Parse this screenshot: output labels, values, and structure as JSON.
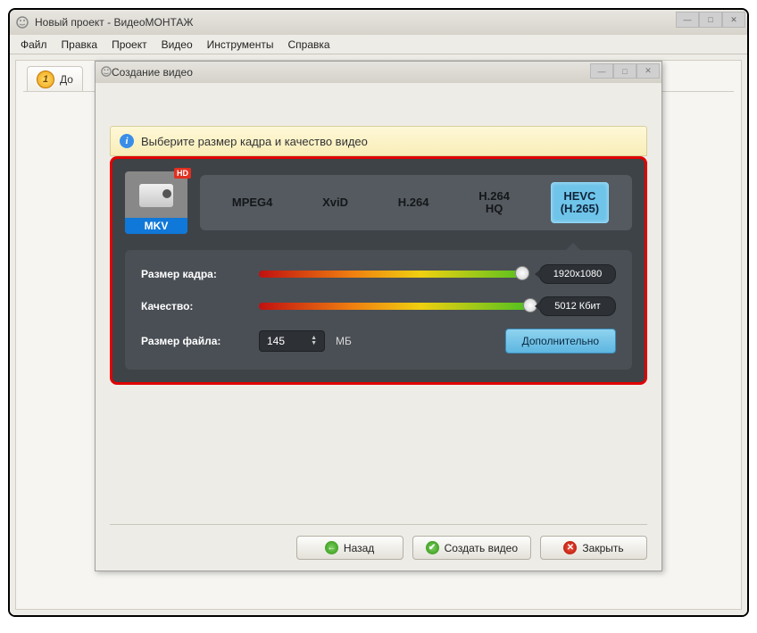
{
  "main_window": {
    "title": "Новый проект - ВидеоМОНТАЖ",
    "menu": [
      "Файл",
      "Правка",
      "Проект",
      "Видео",
      "Инструменты",
      "Справка"
    ],
    "tab": {
      "number": "1",
      "label": "До"
    }
  },
  "dialog": {
    "title": "Создание видео",
    "info_text": "Выберите размер кадра и качество видео",
    "format": {
      "label": "MKV",
      "hd": "HD"
    },
    "codecs": [
      {
        "label": "MPEG4",
        "selected": false
      },
      {
        "label": "XviD",
        "selected": false
      },
      {
        "label": "H.264",
        "selected": false
      },
      {
        "label": "H.264\nHQ",
        "selected": false
      },
      {
        "label": "HEVC\n(H.265)",
        "selected": true
      }
    ],
    "frame_size": {
      "label": "Размер кадра:",
      "value": "1920x1080",
      "percent": 95
    },
    "quality": {
      "label": "Качество:",
      "value": "5012 Кбит",
      "percent": 98
    },
    "file_size": {
      "label": "Размер файла:",
      "value": "145",
      "unit": "МБ"
    },
    "advanced_btn": "Дополнительно",
    "footer": {
      "back": "Назад",
      "create": "Создать видео",
      "close": "Закрыть"
    }
  }
}
